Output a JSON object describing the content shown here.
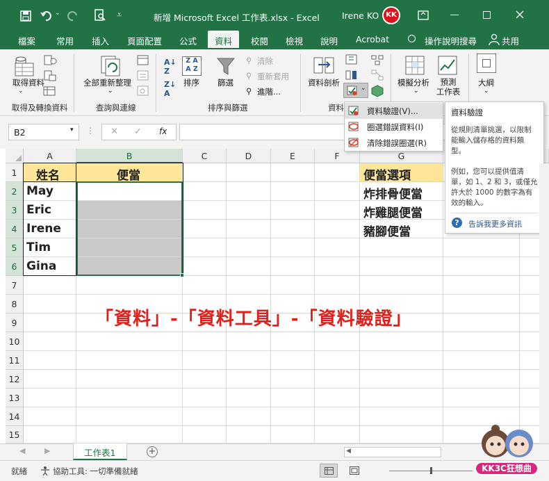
{
  "title_bar": {
    "title": "新增 Microsoft Excel 工作表.xlsx  -  Excel",
    "user": "Irene KO",
    "avatar_text": "KK"
  },
  "tabs": [
    "檔案",
    "常用",
    "插入",
    "頁面配置",
    "公式",
    "資料",
    "校閱",
    "檢視",
    "說明",
    "Acrobat",
    "操作說明搜尋",
    "共用"
  ],
  "ribbon": {
    "get_data": "取得資料",
    "group1": "取得及轉換資料",
    "refresh_all": "全部重新整理",
    "group2": "查詢與連線",
    "sort": "排序",
    "filter": "篩選",
    "clear": "清除",
    "reapply": "重新套用",
    "advanced": "進階...",
    "group3": "排序與篩選",
    "text_to_columns": "資料剖析",
    "group4": "資料",
    "what_if": "模擬分析",
    "forecast": "預測\n工作表",
    "outline": "大綱"
  },
  "name_box": "B2",
  "fx_label": "fx",
  "columns": [
    "A",
    "B",
    "C",
    "D",
    "E",
    "F",
    "G"
  ],
  "rows": [
    "1",
    "2",
    "3",
    "4",
    "5",
    "6",
    "7",
    "8",
    "9",
    "10",
    "11",
    "12",
    "13",
    "14",
    "15"
  ],
  "cells": {
    "A1": "姓名",
    "B1": "便當",
    "A2": "May",
    "A3": "Eric",
    "A4": "Irene",
    "A5": "Tim",
    "A6": "Gina",
    "G1": "便當選項",
    "G2": "炸排骨便當",
    "G3": "炸雞腿便當",
    "G4": "豬腳便當"
  },
  "colors": {
    "excel_green": "#217346",
    "header_fill": "#ffe699",
    "gray_fill": "#c9c9c9",
    "annotation": "#e0201b"
  },
  "dropdown_menu": [
    "資料驗證(V)...",
    "圈選錯誤資料(I)",
    "清除錯誤圈選(R)"
  ],
  "tooltip": {
    "title": "資料驗證",
    "body": "從規則清單挑選，以限制能輸入儲存格的資料類型。\n\n例如，您可以提供值清單，如 1、2 和 3，或僅允許大於 1000 的數字為有效的輸入。",
    "link": "告訴我更多資訊"
  },
  "annotation": "「資料」-「資料工具」-「資料驗證」",
  "sheet_tab": "工作表1",
  "status": {
    "ready": "就緒",
    "accessibility": "協助工具: 一切準備就緒"
  },
  "watermark": "KK3C狂想曲"
}
